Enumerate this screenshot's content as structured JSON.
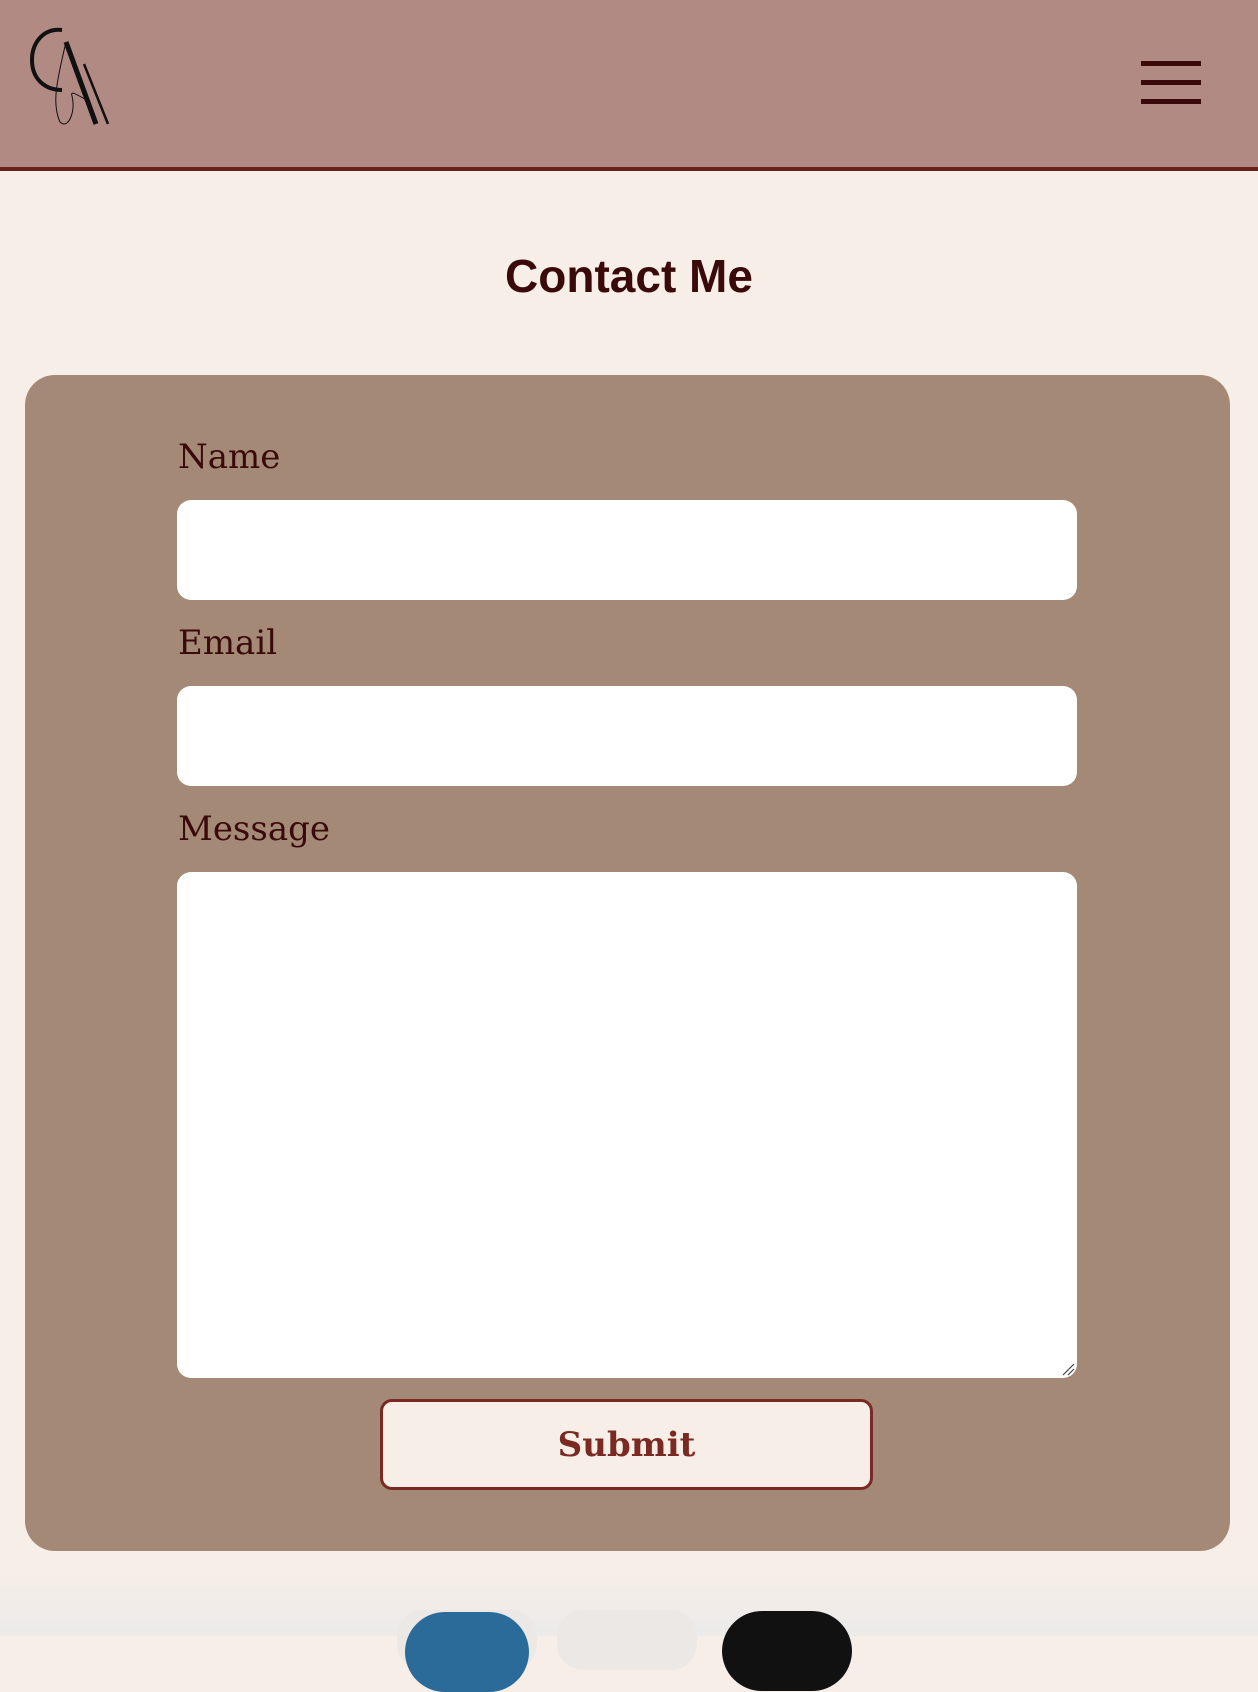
{
  "header": {
    "logo_text": "CA",
    "menu_icon": "hamburger-menu-icon"
  },
  "page": {
    "title": "Contact Me"
  },
  "form": {
    "name_label": "Name",
    "name_value": "",
    "email_label": "Email",
    "email_value": "",
    "message_label": "Message",
    "message_value": "",
    "submit_label": "Submit"
  },
  "colors": {
    "header_bg": "#b28a84",
    "header_border": "#6b2119",
    "page_bg": "#f6eee7",
    "card_bg": "#a48a76",
    "text_dark": "#3a0a0a",
    "button_accent": "#7a2a22"
  },
  "bottom_bar": {
    "icons": [
      "floating-blue-circle-icon",
      "floating-gray-pill-icon",
      "floating-black-circle-icon"
    ]
  }
}
